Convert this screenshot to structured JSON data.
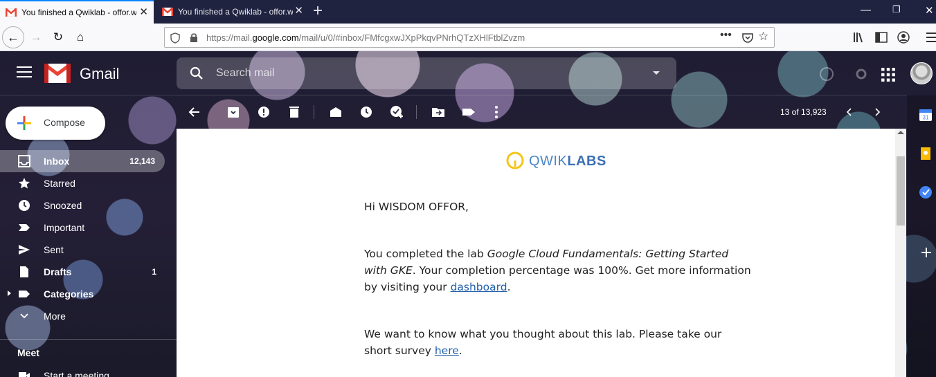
{
  "browser": {
    "tabs": [
      {
        "title": "You finished a Qwiklab - offor.wisdom",
        "active": true
      },
      {
        "title": "You finished a Qwiklab - offor.wisdom",
        "active": false
      }
    ],
    "url_prefix": "https://mail.",
    "url_domain": "google.com",
    "url_path": "/mail/u/0/#inbox/FMfcgxwJXpPkqvPNrhQTzXHlFtblZvzm"
  },
  "gmail": {
    "brand": "Gmail",
    "search_placeholder": "Search mail",
    "compose_label": "Compose",
    "nav": [
      {
        "label": "Inbox",
        "count": "12,143",
        "icon": "inbox-icon",
        "bold": true,
        "active": true
      },
      {
        "label": "Starred",
        "count": "",
        "icon": "star-icon",
        "bold": false,
        "active": false
      },
      {
        "label": "Snoozed",
        "count": "",
        "icon": "clock-icon",
        "bold": false,
        "active": false
      },
      {
        "label": "Important",
        "count": "",
        "icon": "important-icon",
        "bold": false,
        "active": false
      },
      {
        "label": "Sent",
        "count": "",
        "icon": "send-icon",
        "bold": false,
        "active": false
      },
      {
        "label": "Drafts",
        "count": "1",
        "icon": "draft-icon",
        "bold": true,
        "active": false
      },
      {
        "label": "Categories",
        "count": "",
        "icon": "label-icon",
        "bold": true,
        "active": false
      },
      {
        "label": "More",
        "count": "",
        "icon": "chevron-down-icon",
        "bold": false,
        "active": false
      }
    ],
    "meet_title": "Meet",
    "meet_start": "Start a meeting",
    "pager": "13 of 13,923"
  },
  "email": {
    "logo_light": "QWIK",
    "logo_bold": "LABS",
    "greeting": "Hi WISDOM OFFOR,",
    "p1_start": "You completed the lab ",
    "p1_lab": "Google Cloud Fundamentals: Getting Started with GKE",
    "p1_mid": ". Your completion percentage was 100%. Get more information by visiting your ",
    "p1_link": "dashboard",
    "p1_end": ".",
    "p2_start": "We want to know what you thought about this lab. Please take our short survey ",
    "p2_link": "here",
    "p2_end": "."
  },
  "colors": {
    "accent": "#0a84ff",
    "gmail_red": "#ea4335",
    "link": "#1f5ea8",
    "qwiklabs_blue": "#4a86c8",
    "qwiklabs_yellow": "#f5c518"
  }
}
